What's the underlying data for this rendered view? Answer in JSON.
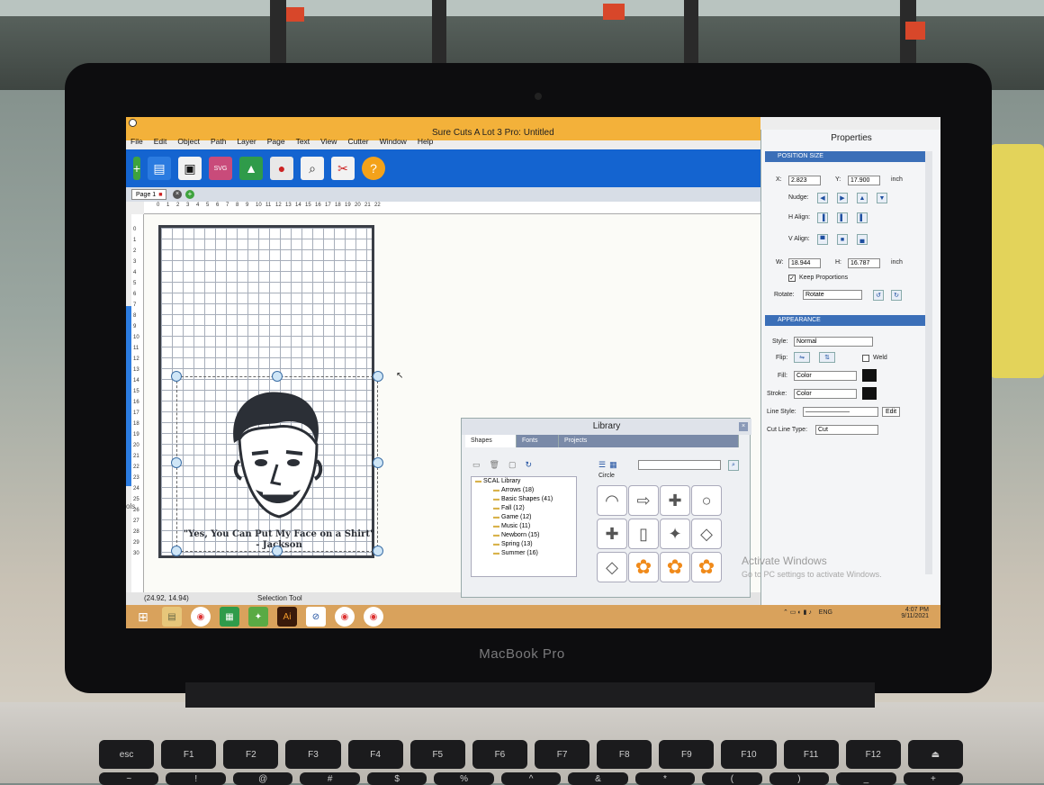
{
  "app": {
    "title": "Sure Cuts A Lot 3 Pro: Untitled",
    "menu": [
      "File",
      "Edit",
      "Object",
      "Path",
      "Layer",
      "Page",
      "Text",
      "View",
      "Cutter",
      "Window",
      "Help"
    ],
    "page_tab": "Page 1",
    "ruler_h_labels": [
      "0",
      "1",
      "2",
      "3",
      "4",
      "5",
      "6",
      "7",
      "8",
      "9",
      "10",
      "11",
      "12",
      "13",
      "14",
      "15",
      "16",
      "17",
      "18",
      "19",
      "20",
      "21",
      "22"
    ],
    "ruler_v_labels": [
      "0",
      "1",
      "2",
      "3",
      "4",
      "5",
      "6",
      "7",
      "8",
      "9",
      "10",
      "11",
      "12",
      "13",
      "14",
      "15",
      "16",
      "17",
      "18",
      "19",
      "20",
      "21",
      "22",
      "23",
      "24",
      "25",
      "26",
      "27",
      "28",
      "29",
      "30"
    ],
    "quote_line1": "\"Yes, You Can Put My Face on a Shirt\"",
    "quote_line2": "- Jackson",
    "status_coords": "(24.92, 14.94)",
    "status_tool": "Selection Tool",
    "side_fragment": "ols"
  },
  "properties": {
    "title": "Properties",
    "position_size": {
      "header": "POSITION SIZE",
      "x_label": "X:",
      "x": "2.823",
      "y_label": "Y:",
      "y": "17.900",
      "unit": "inch",
      "nudge": "Nudge:",
      "h_align": "H Align:",
      "v_align": "V Align:",
      "w_label": "W:",
      "w": "18.944",
      "h_label": "H:",
      "h": "16.787",
      "keep_proportions": "Keep Proportions",
      "rotate_label": "Rotate:",
      "rotate_value": "Rotate"
    },
    "appearance": {
      "header": "APPEARANCE",
      "style_label": "Style:",
      "style_value": "Normal",
      "flip_label": "Flip:",
      "weld": "Weld",
      "fill_label": "Fill:",
      "fill_value": "Color",
      "stroke_label": "Stroke:",
      "stroke_value": "Color",
      "line_style_label": "Line Style:",
      "edit": "Edit",
      "cut_line_label": "Cut Line Type:",
      "cut_line_value": "Cut"
    }
  },
  "library": {
    "title": "Library",
    "tabs": [
      "Shapes",
      "Fonts",
      "Projects"
    ],
    "selected_shape_label": "Circle",
    "tree": [
      "SCAL Library",
      "Arrows (18)",
      "Basic Shapes (41)",
      "Fall (12)",
      "Game (12)",
      "Music (11)",
      "Newborn (15)",
      "Spring (13)",
      "Summer (16)"
    ],
    "shape_icons": [
      "arc",
      "arrow",
      "cross-star",
      "circle",
      "plus",
      "rounded-rect",
      "star4",
      "diamond",
      "diamond-outline",
      "flower",
      "flower",
      "flower"
    ]
  },
  "windows": {
    "activate_line1": "Activate Windows",
    "activate_line2": "Go to PC settings to activate Windows.",
    "lang": "ENG",
    "time": "4:07 PM",
    "date": "9/11/2021"
  },
  "laptop": {
    "brand": "MacBook Pro",
    "keys_row1": [
      "esc",
      "F1",
      "F2",
      "F3",
      "F4",
      "F5",
      "F6",
      "F7",
      "F8",
      "F9",
      "F10",
      "F11",
      "F12",
      "⏏"
    ],
    "keys_row2": [
      "~",
      "!",
      "@",
      "#",
      "$",
      "%",
      "^",
      "&",
      "*",
      "(",
      ")",
      "_",
      "+"
    ]
  }
}
